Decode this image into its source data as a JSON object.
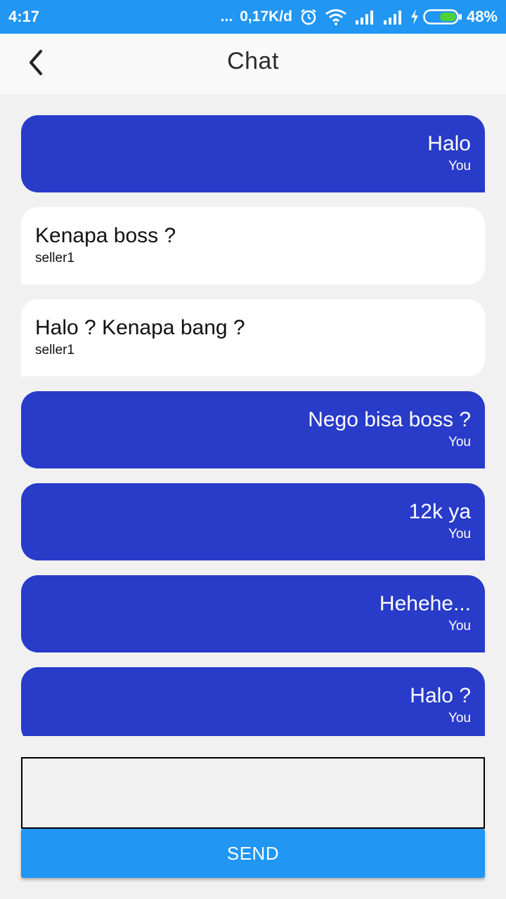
{
  "status_bar": {
    "time": "4:17",
    "dots": "...",
    "speed": "0,17K/d",
    "battery_percent": "48%",
    "icons": [
      "alarm-icon",
      "wifi-icon",
      "signal-icon",
      "signal-icon",
      "charging-icon",
      "battery-icon"
    ]
  },
  "app_bar": {
    "title": "Chat",
    "back_icon": "chevron-left-icon"
  },
  "messages": [
    {
      "text": "Halo",
      "sender": "You",
      "self": true
    },
    {
      "text": "Kenapa boss ?",
      "sender": "seller1",
      "self": false
    },
    {
      "text": "Halo ? Kenapa bang ?",
      "sender": "seller1",
      "self": false
    },
    {
      "text": "Nego bisa boss ?",
      "sender": "You",
      "self": true
    },
    {
      "text": "12k ya",
      "sender": "You",
      "self": true
    },
    {
      "text": "Hehehe...",
      "sender": "You",
      "self": true
    },
    {
      "text": "Halo ?",
      "sender": "You",
      "self": true
    }
  ],
  "composer": {
    "value": "",
    "send_label": "SEND"
  },
  "colors": {
    "status_bar": "#2196f3",
    "self_bubble": "#283bc9",
    "other_bubble": "#ffffff",
    "background": "#f1f1f1",
    "send_button": "#2196f3"
  }
}
